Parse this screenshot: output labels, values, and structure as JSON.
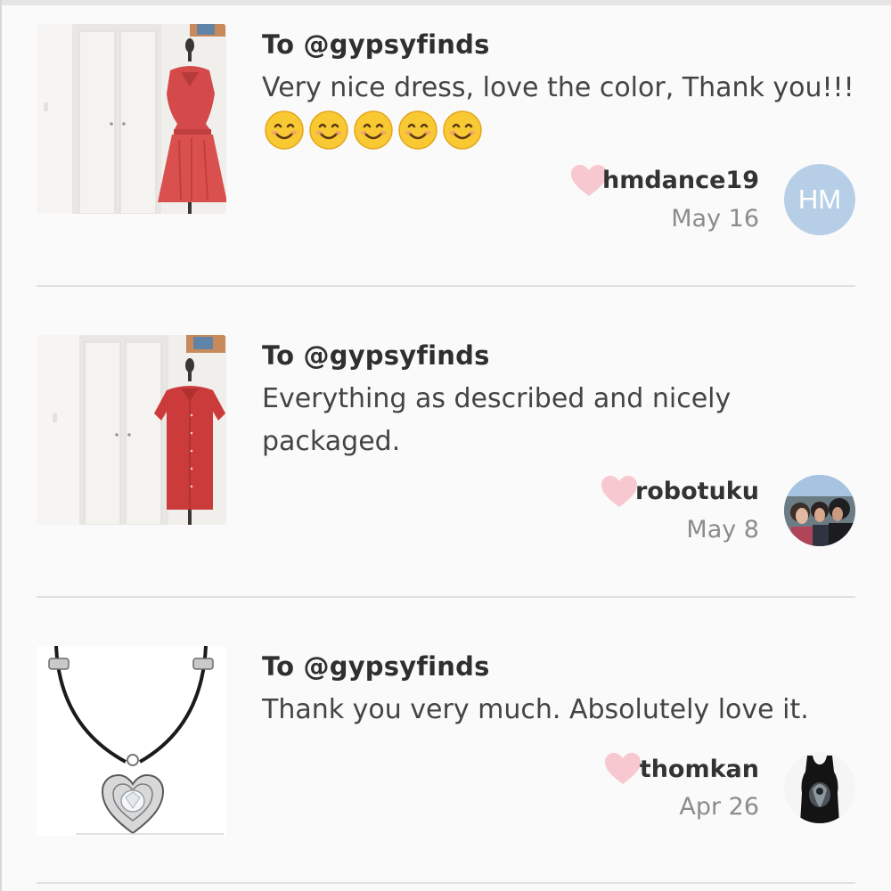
{
  "feed": [
    {
      "to": "To @gypsyfinds",
      "message": "Very nice dress, love the color, Thank you!!!",
      "emojis": [
        "smiling-face-icon",
        "smiling-face-icon",
        "smiling-face-icon",
        "smiling-face-icon",
        "smiling-face-icon"
      ],
      "author": "hmdance19",
      "date": "May 16",
      "avatar_initials": "HM",
      "item_image": "red-sleeveless-dress-on-mannequin"
    },
    {
      "to": "To @gypsyfinds",
      "message": "Everything as described and nicely packaged.",
      "author": "robotuku",
      "date": "May 8",
      "avatar_image": "group-photo-avatar",
      "item_image": "red-shirt-dress-on-mannequin"
    },
    {
      "to": "To @gypsyfinds",
      "message": "Thank you very much. Absolutely love it.",
      "author": "thomkan",
      "date": "Apr 26",
      "avatar_image": "black-tank-top-avatar",
      "item_image": "heart-pendant-necklace"
    }
  ],
  "colors": {
    "heart": "#f8c8d0",
    "avatar_initials_bg": "#b7cfe6",
    "dress_red": "#d44a4a",
    "divider": "#e1dfdf"
  }
}
